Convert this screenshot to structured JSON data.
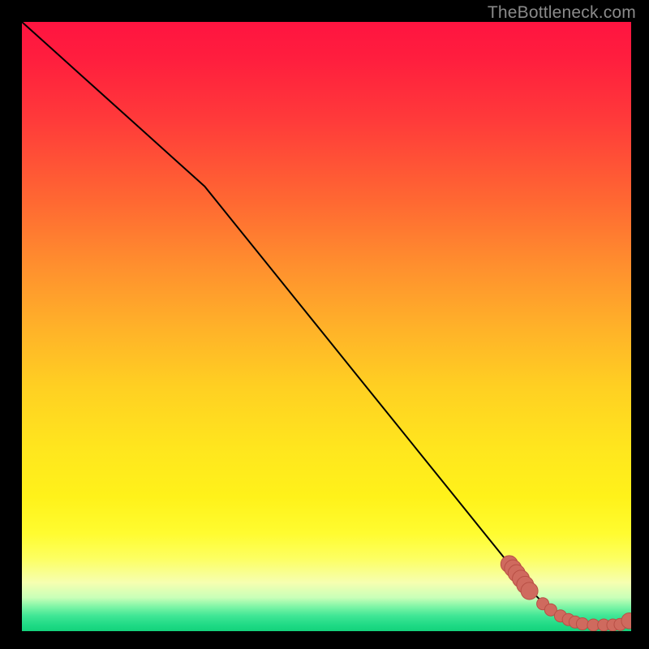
{
  "watermark": "TheBottleneck.com",
  "colors": {
    "line": "#000000",
    "point_fill": "#cf6a5e",
    "point_stroke": "#b84f45",
    "bg_black": "#000000"
  },
  "chart_data": {
    "type": "line",
    "title": "",
    "xlabel": "",
    "ylabel": "",
    "xlim": [
      0,
      100
    ],
    "ylim": [
      0,
      100
    ],
    "series": [
      {
        "name": "curve",
        "x": [
          0,
          5,
          10,
          15,
          20,
          25,
          30,
          35,
          40,
          45,
          50,
          55,
          60,
          65,
          70,
          75,
          80,
          82,
          84,
          86,
          88,
          90,
          92,
          94,
          96,
          98,
          99,
          100
        ],
        "y": [
          100,
          95.5,
          91,
          86.5,
          82,
          77.5,
          73,
          66.8,
          60.6,
          54.4,
          48.2,
          42,
          35.8,
          29.6,
          23.4,
          17.2,
          11,
          8.5,
          6.2,
          4.2,
          2.8,
          1.8,
          1.2,
          1.0,
          1.0,
          1.0,
          1.2,
          1.7
        ]
      }
    ],
    "points": [
      {
        "x": 80.0,
        "y": 11.0,
        "r": 1.4
      },
      {
        "x": 80.6,
        "y": 10.3,
        "r": 1.4
      },
      {
        "x": 81.2,
        "y": 9.5,
        "r": 1.4
      },
      {
        "x": 81.9,
        "y": 8.6,
        "r": 1.4
      },
      {
        "x": 82.6,
        "y": 7.6,
        "r": 1.4
      },
      {
        "x": 83.3,
        "y": 6.6,
        "r": 1.4
      },
      {
        "x": 85.5,
        "y": 4.5,
        "r": 1.0
      },
      {
        "x": 86.8,
        "y": 3.5,
        "r": 1.0
      },
      {
        "x": 88.4,
        "y": 2.5,
        "r": 1.0
      },
      {
        "x": 89.7,
        "y": 1.9,
        "r": 1.0
      },
      {
        "x": 90.8,
        "y": 1.5,
        "r": 1.0
      },
      {
        "x": 92.0,
        "y": 1.2,
        "r": 1.0
      },
      {
        "x": 93.8,
        "y": 1.0,
        "r": 1.0
      },
      {
        "x": 95.5,
        "y": 1.0,
        "r": 1.0
      },
      {
        "x": 97.0,
        "y": 1.0,
        "r": 1.0
      },
      {
        "x": 98.2,
        "y": 1.1,
        "r": 1.0
      },
      {
        "x": 99.7,
        "y": 1.7,
        "r": 1.3
      }
    ]
  }
}
